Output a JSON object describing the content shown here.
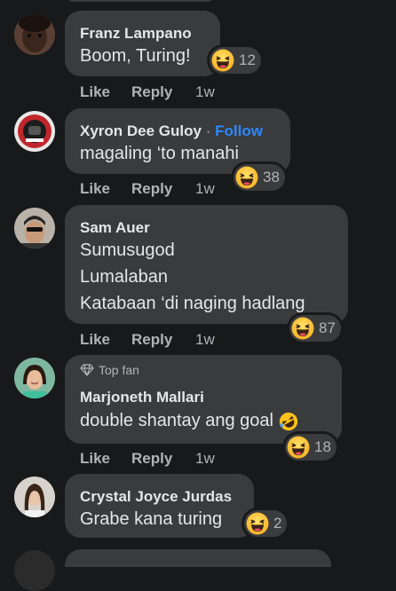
{
  "comments": [
    {
      "name": "Franz Lampano",
      "lines": [
        "Boom, Turing!"
      ],
      "reaction_count": "12",
      "actions": {
        "like": "Like",
        "reply": "Reply",
        "time": "1w"
      }
    },
    {
      "name": "Xyron Dee Guloy",
      "follow_sep": "·",
      "follow": "Follow",
      "lines": [
        "magaling ‘to manahi"
      ],
      "reaction_count": "38",
      "actions": {
        "like": "Like",
        "reply": "Reply",
        "time": "1w"
      }
    },
    {
      "name": "Sam Auer",
      "lines": [
        "Sumusugod",
        "Lumalaban",
        "Katabaan ‘di naging hadlang"
      ],
      "reaction_count": "87",
      "actions": {
        "like": "Like",
        "reply": "Reply",
        "time": "1w"
      }
    },
    {
      "badge": "Top fan",
      "name": "Marjoneth Mallari",
      "lines": [
        "double shantay ang goal"
      ],
      "reaction_count": "18",
      "actions": {
        "like": "Like",
        "reply": "Reply",
        "time": "1w"
      }
    },
    {
      "name": "Crystal Joyce Jurdas",
      "lines": [
        "Grabe kana turing"
      ],
      "reaction_count": "2"
    }
  ],
  "colors": {
    "background": "#18191a",
    "bubble": "#3a3b3c",
    "text": "#e4e6eb",
    "secondary_text": "#b0b3b8",
    "follow_link": "#2d88ff"
  },
  "icons": {
    "reaction": "haha-emoji-icon",
    "inline_emoji": "rofl-emoji-icon",
    "badge": "diamond-icon"
  }
}
